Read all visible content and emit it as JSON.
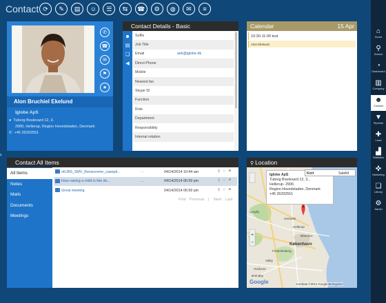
{
  "app": {
    "title": "Contact"
  },
  "toolbar": [
    {
      "name": "refresh-icon",
      "glyph": "⟳"
    },
    {
      "name": "person-edit-icon",
      "glyph": "✎"
    },
    {
      "name": "document-icon",
      "glyph": "▤"
    },
    {
      "name": "people-icon",
      "glyph": "☺"
    },
    {
      "name": "task-list-icon",
      "glyph": "☰"
    },
    {
      "name": "share-icon",
      "glyph": "⇆"
    },
    {
      "name": "phone-call-icon",
      "glyph": "☎"
    },
    {
      "name": "settings-icon",
      "glyph": "⚙"
    },
    {
      "name": "globe-icon",
      "glyph": "◍"
    },
    {
      "name": "mail-icon",
      "glyph": "✉"
    },
    {
      "name": "add-list-icon",
      "glyph": "≡"
    }
  ],
  "sidebar_nav": [
    {
      "label": "Home",
      "icon": "home-icon",
      "glyph": "⌂"
    },
    {
      "label": "Search",
      "icon": "search-icon",
      "glyph": "⚲"
    },
    {
      "label": "Dashboard",
      "icon": "dashboard-icon",
      "glyph": "◔"
    },
    {
      "label": "Company",
      "icon": "company-icon",
      "glyph": "▥"
    },
    {
      "label": "Contact",
      "icon": "contact-icon",
      "glyph": "☻"
    },
    {
      "label": "Pipeline",
      "icon": "pipeline-icon",
      "glyph": "▼"
    },
    {
      "label": "Lead",
      "icon": "lead-icon",
      "glyph": "✚"
    },
    {
      "label": "Statistics",
      "icon": "statistics-icon",
      "glyph": "▟"
    },
    {
      "label": "Marketing",
      "icon": "marketing-icon",
      "glyph": "✜"
    },
    {
      "label": "Library",
      "icon": "library-icon",
      "glyph": "❏"
    },
    {
      "label": "Admin",
      "icon": "admin-icon",
      "glyph": "⚙"
    }
  ],
  "contact": {
    "name": "Alon Bruchiel Ekelund",
    "company": "Iglobe ApS",
    "address_line1": "Tuborg Boulevard 12, 3.",
    "address_line2": "2900, Hellerup, Region Hovedstaden, Denmark",
    "phone": "+45 26292551",
    "actions": [
      {
        "name": "contact-skype-icon",
        "glyph": "✆"
      },
      {
        "name": "contact-phone-icon",
        "glyph": "☎"
      },
      {
        "name": "contact-mail-icon",
        "glyph": "✉"
      },
      {
        "name": "contact-flag-icon",
        "glyph": "⚑"
      },
      {
        "name": "contact-star-icon",
        "glyph": "★"
      }
    ]
  },
  "details": {
    "title": "Contact Details - Basic",
    "fields": [
      {
        "label": "Suffix",
        "value": ""
      },
      {
        "label": "Job Title",
        "value": ""
      },
      {
        "label": "Email",
        "value": "aek@iglobe.dk"
      },
      {
        "label": "Direct Phone",
        "value": ""
      },
      {
        "label": "Mobile",
        "value": ""
      },
      {
        "label": "Nearest fax",
        "value": ""
      },
      {
        "label": "Skype ID",
        "value": ""
      },
      {
        "label": "Function",
        "value": ""
      },
      {
        "label": "Role",
        "value": ""
      },
      {
        "label": "Department",
        "value": ""
      },
      {
        "label": "Responsibility",
        "value": ""
      },
      {
        "label": "Internal relation",
        "value": ""
      }
    ]
  },
  "calendar": {
    "title": "Calendar",
    "date": "15 Apr",
    "events": [
      {
        "text": "10:30-11:00 test"
      },
      {
        "text": "Alon Ekelund."
      }
    ]
  },
  "all_items": {
    "title": "Contact All Items",
    "nav": [
      "All Items",
      "Notes",
      "Mails",
      "Documents",
      "Meetings"
    ],
    "rows": [
      {
        "title": "ofc365_SMV_Reviscreme_casepd...",
        "dots": "...",
        "date": "04/14/2014 10:44 am",
        "flags": "$ ☆ ⚑"
      },
      {
        "title": "How raising a child is like de...",
        "dots": "...",
        "date": "04/14/2014 06:59 pm",
        "flags": "$ ☆ ⚑"
      },
      {
        "title": "Great meeting",
        "dots": "",
        "date": "04/14/2014 06:59 pm",
        "flags": "$ ☆ ⚑"
      }
    ],
    "pager": {
      "first": "First",
      "previous": "Previous",
      "sep": "|",
      "next": "Next",
      "last": "Last"
    }
  },
  "location": {
    "title": "Location",
    "info": {
      "company": "Iglobe ApS",
      "line1": "Tuborg Boulevard 12, 3.,",
      "line2": "Hellerup- 2900,",
      "line3": "Region Hovedstaden, Denmark",
      "line4": "+45 26292551"
    },
    "map_type": {
      "map": "Kort",
      "satellite": "Satellit"
    },
    "places": [
      "Lyngby",
      "Gentofte",
      "Hellerup",
      "Østerbro",
      "København",
      "Frederiksberg",
      "Valby",
      "Hvidovre",
      "Brøndby"
    ],
    "copyright": "Kortdata ©2014 Google   Betingelser",
    "google": "Google"
  }
}
